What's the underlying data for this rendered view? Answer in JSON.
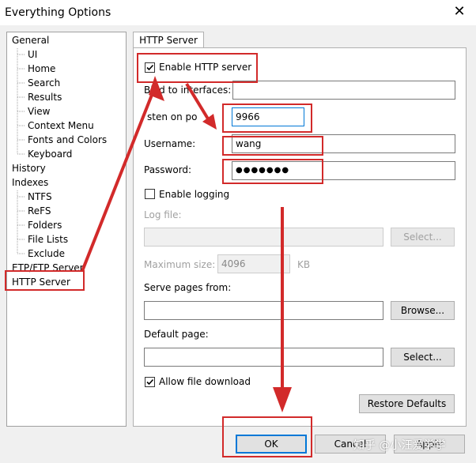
{
  "window": {
    "title": "Everything Options"
  },
  "tree": {
    "items": [
      {
        "label": "General"
      },
      {
        "label": "UI"
      },
      {
        "label": "Home"
      },
      {
        "label": "Search"
      },
      {
        "label": "Results"
      },
      {
        "label": "View"
      },
      {
        "label": "Context Menu"
      },
      {
        "label": "Fonts and Colors"
      },
      {
        "label": "Keyboard"
      },
      {
        "label": "History"
      },
      {
        "label": "Indexes"
      },
      {
        "label": "NTFS"
      },
      {
        "label": "ReFS"
      },
      {
        "label": "Folders"
      },
      {
        "label": "File Lists"
      },
      {
        "label": "Exclude"
      },
      {
        "label": "ETP/FTP Server"
      },
      {
        "label": "HTTP Server"
      }
    ]
  },
  "tab": {
    "label": "HTTP Server"
  },
  "http": {
    "enable_label": "Enable HTTP server",
    "bind_label": "Bind to interfaces:",
    "bind_value": "",
    "port_label": "sten on po",
    "port_value": "9966",
    "username_label": "Username:",
    "username_value": "wang",
    "password_label": "Password:",
    "password_value": "●●●●●●●",
    "logging_label": "Enable logging",
    "logfile_label": "Log file:",
    "logfile_value": "",
    "logfile_select": "Select...",
    "maxsize_label": "Maximum size:",
    "maxsize_value": "4096",
    "maxsize_unit": "KB",
    "serve_label": "Serve pages from:",
    "serve_value": "",
    "browse_label": "Browse...",
    "default_label": "Default page:",
    "default_value": "",
    "default_select": "Select...",
    "download_label": "Allow file download",
    "restore_label": "Restore Defaults"
  },
  "footer": {
    "ok": "OK",
    "cancel": "Cancel",
    "apply": "Apply"
  },
  "watermark": "知乎 @小汪爱学学",
  "colors": {
    "annotation": "#d22a2a",
    "focus": "#0078d7"
  }
}
